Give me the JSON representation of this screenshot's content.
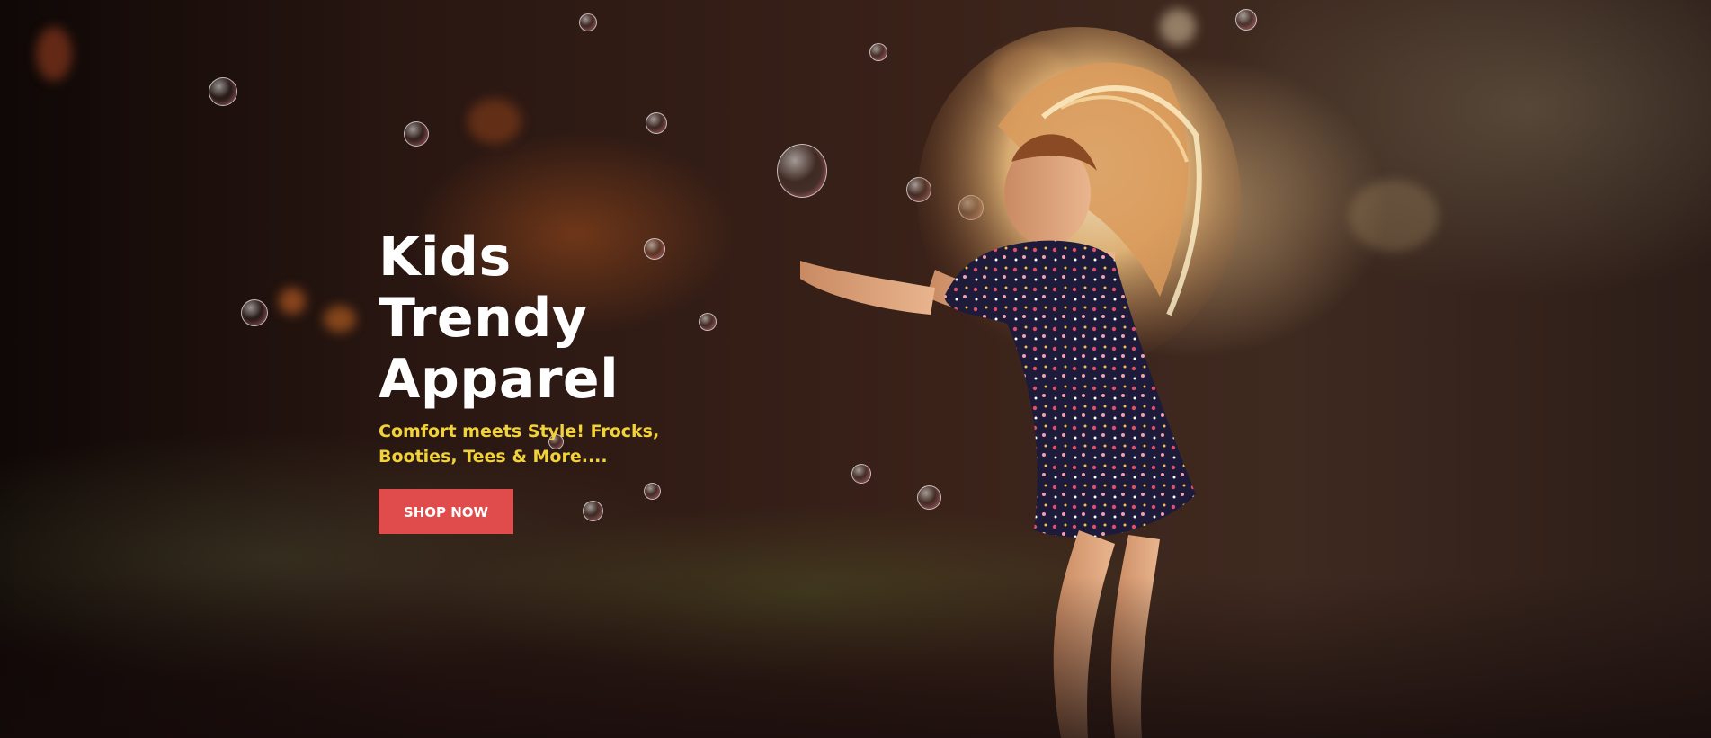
{
  "hero": {
    "title_line1": "Kids Trendy",
    "title_line2": "Apparel",
    "subtitle": "Comfort meets Style! Frocks, Booties, Tees & More....",
    "cta_label": "SHOP NOW"
  },
  "colors": {
    "title": "#ffffff",
    "subtitle": "#f2d23a",
    "button_bg": "#e04b4b",
    "button_text": "#ffffff"
  },
  "image": {
    "subject": "girl-with-bubbles-photo"
  }
}
